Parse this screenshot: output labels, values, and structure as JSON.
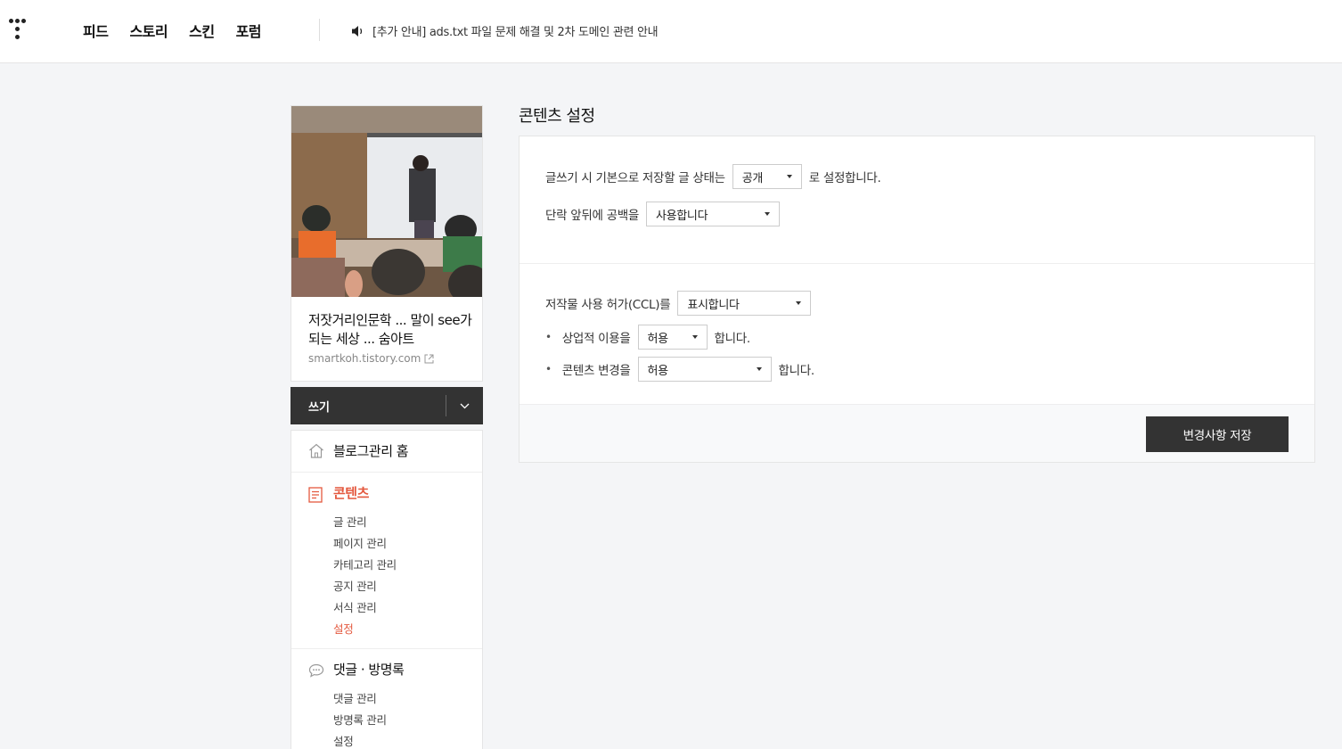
{
  "header": {
    "nav": [
      "피드",
      "스토리",
      "스킨",
      "포럼"
    ],
    "notice": "[추가 안내] ads.txt 파일 문제 해결 및 2차 도메인 관련 안내"
  },
  "sidebar": {
    "blog_title": "저잣거리인문학 ... 말이 see가 되는 세상 ... 숨아트",
    "blog_url": "smartkoh.tistory.com",
    "write_label": "쓰기",
    "home_label": "블로그관리 홈",
    "contents": {
      "head": "콘텐츠",
      "items": [
        "글 관리",
        "페이지 관리",
        "카테고리 관리",
        "공지 관리",
        "서식 관리",
        "설정"
      ]
    },
    "comments": {
      "head": "댓글 · 방명록",
      "items": [
        "댓글 관리",
        "방명록 관리",
        "설정"
      ]
    }
  },
  "main": {
    "title": "콘텐츠 설정",
    "default_state": {
      "prefix": "글쓰기 시 기본으로 저장할 글 상태는",
      "value": "공개",
      "suffix": "로 설정합니다."
    },
    "paragraph_space": {
      "prefix": "단락 앞뒤에 공백을",
      "value": "사용합니다"
    },
    "ccl": {
      "prefix": "저작물 사용 허가(CCL)를",
      "value": "표시합니다"
    },
    "commercial": {
      "prefix": "상업적 이용을",
      "value": "허용",
      "suffix": "합니다."
    },
    "modification": {
      "prefix": "콘텐츠 변경을",
      "value": "허용",
      "suffix": "합니다."
    },
    "save_label": "변경사항 저장"
  }
}
